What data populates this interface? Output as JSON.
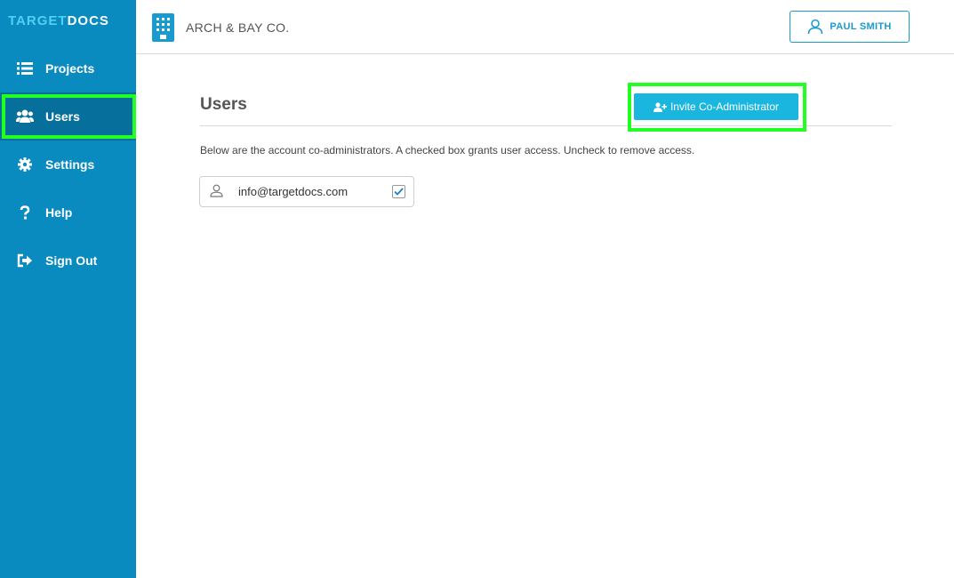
{
  "brand": {
    "logo_part1": "TARGET",
    "logo_part2": "DOCS"
  },
  "sidebar": {
    "items": [
      {
        "label": "Projects",
        "icon": "list-icon"
      },
      {
        "label": "Users",
        "icon": "users-icon",
        "active": true
      },
      {
        "label": "Settings",
        "icon": "gear-icon"
      },
      {
        "label": "Help",
        "icon": "question-icon"
      },
      {
        "label": "Sign Out",
        "icon": "sign-out-icon"
      }
    ]
  },
  "header": {
    "org_name": "ARCH & BAY CO.",
    "user_name": "PAUL SMITH"
  },
  "main": {
    "title": "Users",
    "invite_label": "Invite Co-Administrator",
    "description": "Below are the account co-administrators. A checked box grants user access. Uncheck to remove access.",
    "users": [
      {
        "email": "info@targetdocs.com",
        "checked": true
      }
    ]
  },
  "colors": {
    "sidebar_bg": "#0a8bc0",
    "accent": "#1a9bd0",
    "highlight": "#22ff22"
  }
}
